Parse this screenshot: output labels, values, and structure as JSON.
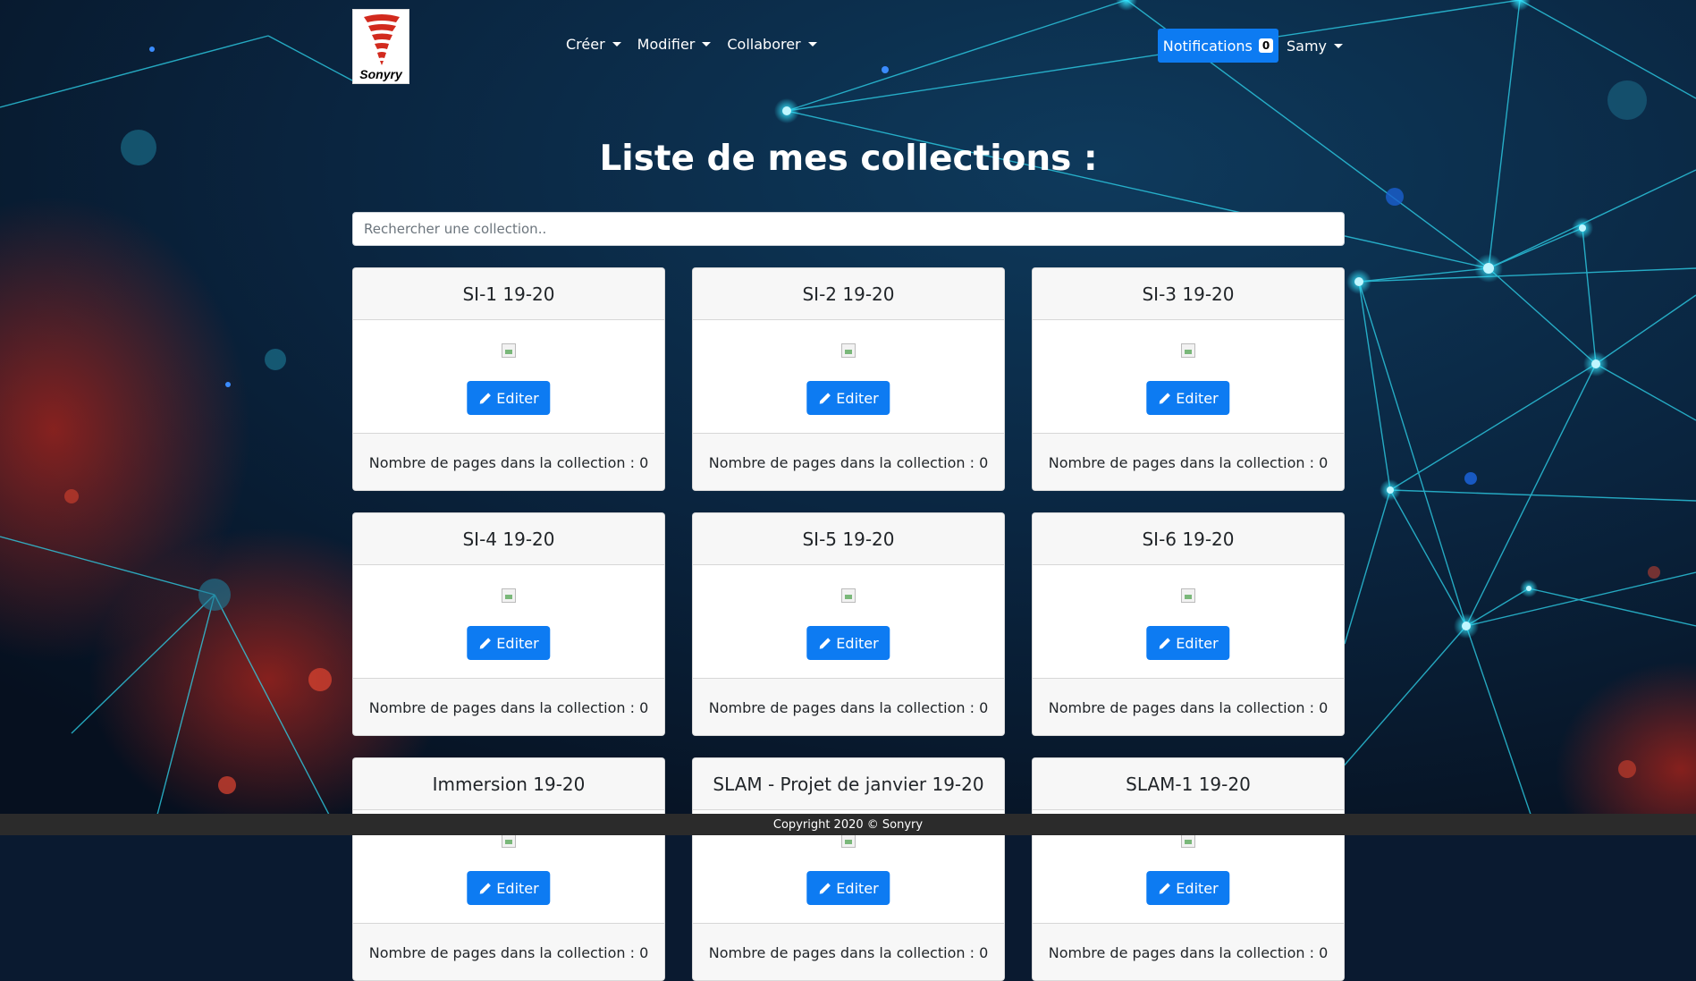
{
  "brand": {
    "logo_text": "Sonyry"
  },
  "nav": {
    "items": [
      {
        "label": "Créer"
      },
      {
        "label": "Modifier"
      },
      {
        "label": "Collaborer"
      }
    ],
    "notifications_label": "Notifications",
    "notifications_count": "0",
    "user_label": "Samy"
  },
  "main": {
    "title": "Liste de mes collections :",
    "search_placeholder": "Rechercher une collection.."
  },
  "collections": [
    {
      "name": "SI-1 19-20",
      "edit_label": "Editer",
      "pages_text": "Nombre de pages dans la collection : 0"
    },
    {
      "name": "SI-2 19-20",
      "edit_label": "Editer",
      "pages_text": "Nombre de pages dans la collection : 0"
    },
    {
      "name": "SI-3 19-20",
      "edit_label": "Editer",
      "pages_text": "Nombre de pages dans la collection : 0"
    },
    {
      "name": "SI-4 19-20",
      "edit_label": "Editer",
      "pages_text": "Nombre de pages dans la collection : 0"
    },
    {
      "name": "SI-5 19-20",
      "edit_label": "Editer",
      "pages_text": "Nombre de pages dans la collection : 0"
    },
    {
      "name": "SI-6 19-20",
      "edit_label": "Editer",
      "pages_text": "Nombre de pages dans la collection : 0"
    },
    {
      "name": "Immersion 19-20",
      "edit_label": "Editer",
      "pages_text": "Nombre de pages dans la collection : 0"
    },
    {
      "name": "SLAM - Projet de janvier 19-20",
      "edit_label": "Editer",
      "pages_text": "Nombre de pages dans la collection : 0"
    },
    {
      "name": "SLAM-1 19-20",
      "edit_label": "Editer",
      "pages_text": "Nombre de pages dans la collection : 0"
    }
  ],
  "footer": {
    "copyright": "Copyright 2020 © Sonyry"
  },
  "colors": {
    "primary": "#0d7bf2",
    "background": "#0a1a30",
    "network_line": "#2fd7ef",
    "footer_bg": "#2b2b2b"
  }
}
